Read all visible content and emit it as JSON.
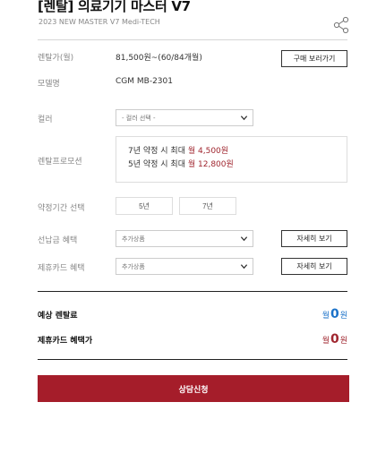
{
  "product": {
    "title": "[렌탈] 의료기기 마스터 V7",
    "subtitle": "2023 NEW MASTER V7 Medi-TECH"
  },
  "rental_price": {
    "label": "렌탈가(월)",
    "value": "81,500원~(60/84개월)",
    "button": "구매 보러가기"
  },
  "model": {
    "label": "모델명",
    "value": "CGM MB-2301"
  },
  "color": {
    "label": "컬러",
    "placeholder": "- 컬러 선택 -"
  },
  "promotion": {
    "label": "렌탈프로모션",
    "lines": [
      {
        "text": "7년 약정 시 최대",
        "price": "월 4,500원"
      },
      {
        "text": "5년 약정 시 최대",
        "price": "월 12,800원"
      }
    ]
  },
  "term": {
    "label": "약정기간 선택",
    "options": [
      "5년",
      "7년"
    ]
  },
  "prepay": {
    "label": "선납금 혜택",
    "select": "추가상품",
    "button": "자세히 보기"
  },
  "card": {
    "label": "제휴카드 혜택",
    "select": "추가상품",
    "button": "자세히 보기"
  },
  "summary": {
    "expected": {
      "label": "예상 렌탈료",
      "prefix": "월",
      "amount": "0",
      "suffix": "원",
      "color": "#1b72c9"
    },
    "card_benefit": {
      "label": "제휴카드 혜택가",
      "prefix": "월",
      "amount": "0",
      "suffix": "원",
      "color": "#a0262f"
    }
  },
  "cta": {
    "label": "상담신청",
    "color": "#a51d2a"
  },
  "icons": {
    "share": "share-icon",
    "chevron": "chevron-down-icon"
  }
}
